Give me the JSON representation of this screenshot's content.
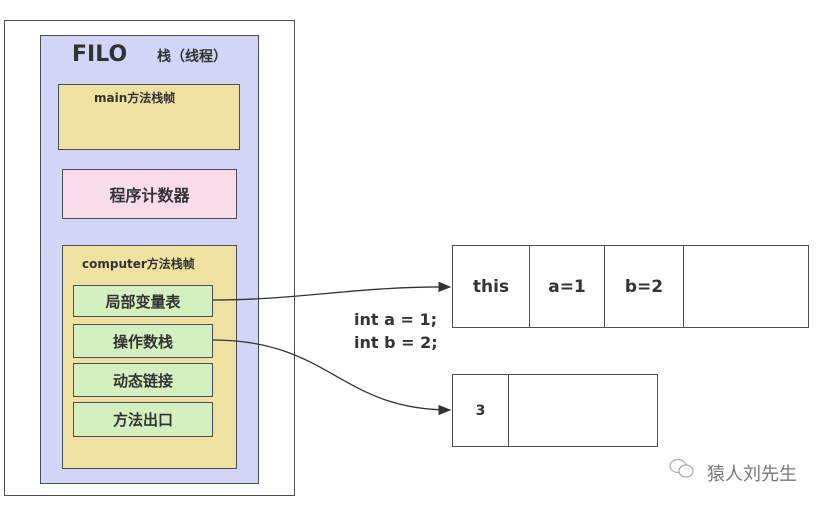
{
  "stack": {
    "fifo_label": "FILO",
    "title": "栈（线程）",
    "main_frame": "main方法栈帧",
    "pc": "程序计数器",
    "computer_frame": "computer方法栈帧",
    "parts": [
      "局部变量表",
      "操作数栈",
      "动态链接",
      "方法出口"
    ]
  },
  "local_vars": [
    "this",
    "a=1",
    "b=2",
    ""
  ],
  "operand_stack": [
    "3",
    ""
  ],
  "code": [
    "int a = 1;",
    "int b = 2;"
  ],
  "watermark": "猿人刘先生",
  "colors": {
    "stack": "#d3d5f6",
    "frame": "#efe1a2",
    "pc": "#f9dcea",
    "part": "#d5f0c0"
  }
}
